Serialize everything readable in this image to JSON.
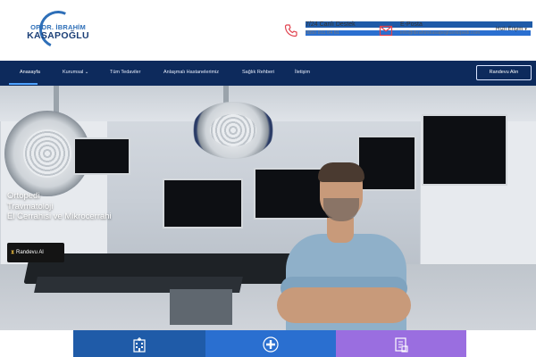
{
  "logo": {
    "line1": "OP.DR. İBRAHİM",
    "line2": "KASAPOĞLU"
  },
  "contacts": [
    {
      "icon": "phone-icon",
      "title": "7/24 Canlı Destek",
      "detail": "0850 811 04 61"
    },
    {
      "icon": "envelope-icon",
      "title": "E-Posta",
      "detail": "info@ibrahimkasapogluortopedi.com"
    }
  ],
  "quick_access": {
    "label": "Hızlı Erişim",
    "icon": "caret-down-icon"
  },
  "nav": {
    "items": [
      {
        "label": "Anasayfa",
        "active": true
      },
      {
        "label": "Kurumsal",
        "has_dropdown": true
      },
      {
        "label": "Tüm Tedaviler"
      },
      {
        "label": "Anlaşmalı Hastanelerimiz"
      },
      {
        "label": "Sağlık Rehberi"
      },
      {
        "label": "İletişim"
      }
    ],
    "cta_label": "Randevu Alın"
  },
  "hero": {
    "lines": [
      "Ortopedi",
      "Travmatoloji",
      "El Cerrahisi ve Mikrocerrahi"
    ],
    "button_label": "Randevu Al",
    "button_icon": "hourglass-icon"
  },
  "tiles": [
    {
      "icon": "hospital-icon",
      "color": "#1f5ba8"
    },
    {
      "icon": "medical-cross-icon",
      "color": "#2a6fd0"
    },
    {
      "icon": "document-icon",
      "color": "#9a6ee0"
    }
  ],
  "colors": {
    "brand_blue": "#2e6fb8",
    "nav_bg": "#0d2a5c",
    "accent_red": "#e0434f"
  }
}
